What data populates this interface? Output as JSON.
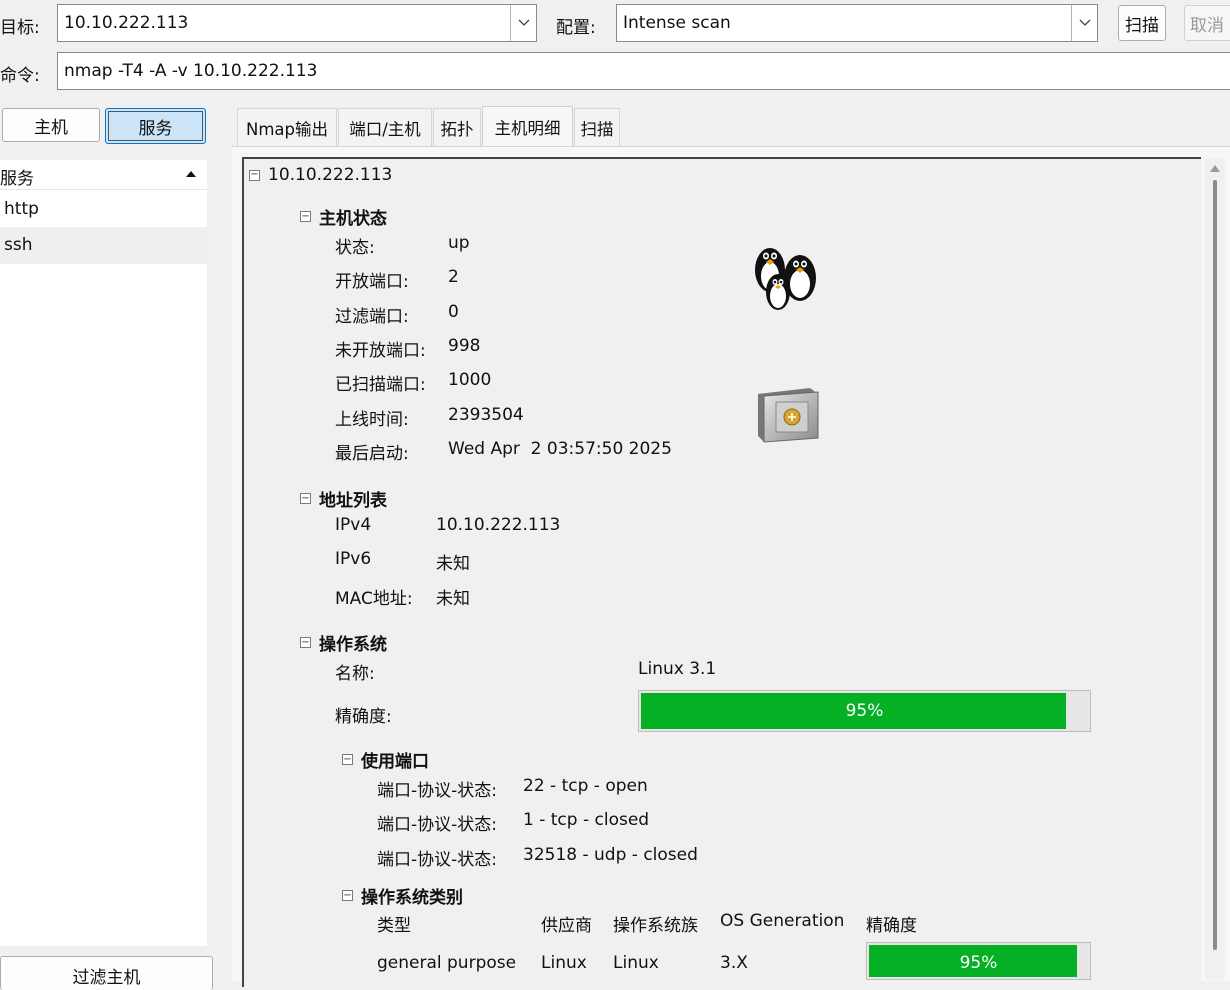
{
  "toolbar": {
    "target_label": "目标:",
    "target_value": "10.10.222.113",
    "profile_label": "配置:",
    "profile_value": "Intense scan",
    "scan_button": "扫描",
    "cancel_button": "取消",
    "command_label": "命令:",
    "command_value": "nmap -T4 -A -v 10.10.222.113"
  },
  "left_panel": {
    "host_button": "主机",
    "service_button": "服务",
    "list_header": "服务",
    "services": [
      "http",
      "ssh"
    ],
    "filter_button": "过滤主机"
  },
  "tabs": [
    "Nmap输出",
    "端口/主机",
    "拓扑",
    "主机明细",
    "扫描"
  ],
  "active_tab": "主机明细",
  "details": {
    "host": "10.10.222.113",
    "host_status": {
      "title": "主机状态",
      "rows": [
        {
          "label": "状态:",
          "value": "up"
        },
        {
          "label": "开放端口:",
          "value": "2"
        },
        {
          "label": "过滤端口:",
          "value": "0"
        },
        {
          "label": "未开放端口:",
          "value": "998"
        },
        {
          "label": "已扫描端口:",
          "value": "1000"
        },
        {
          "label": "上线时间:",
          "value": "2393504"
        },
        {
          "label": "最后启动:",
          "value": "Wed Apr  2 03:57:50 2025"
        }
      ]
    },
    "addresses": {
      "title": "地址列表",
      "rows": [
        {
          "label": "IPv4",
          "value": "10.10.222.113"
        },
        {
          "label": "IPv6",
          "value": "未知"
        },
        {
          "label": "MAC地址:",
          "value": "未知"
        }
      ]
    },
    "os": {
      "title": "操作系统",
      "name_label": "名称:",
      "name_value": "Linux 3.1",
      "accuracy_label": "精确度:",
      "accuracy_text": "95%",
      "accuracy_fraction": 0.95,
      "ports_used": {
        "title": "使用端口",
        "label": "端口-协议-状态:",
        "rows": [
          "22 - tcp - open",
          "1 - tcp - closed",
          "32518 - udp - closed"
        ]
      },
      "os_class": {
        "title": "操作系统类别",
        "headers": [
          "类型",
          "供应商",
          "操作系统族",
          "OS Generation",
          "精确度"
        ],
        "rows": [
          {
            "type": "general purpose",
            "vendor": "Linux",
            "family": "Linux",
            "generation": "3.X",
            "accuracy": "95%",
            "accuracy_fraction": 0.95
          }
        ]
      }
    }
  },
  "colors": {
    "progress_green": "#06b025"
  },
  "icons": [
    "linux-penguins-icon",
    "vulnerability-safe-icon"
  ]
}
